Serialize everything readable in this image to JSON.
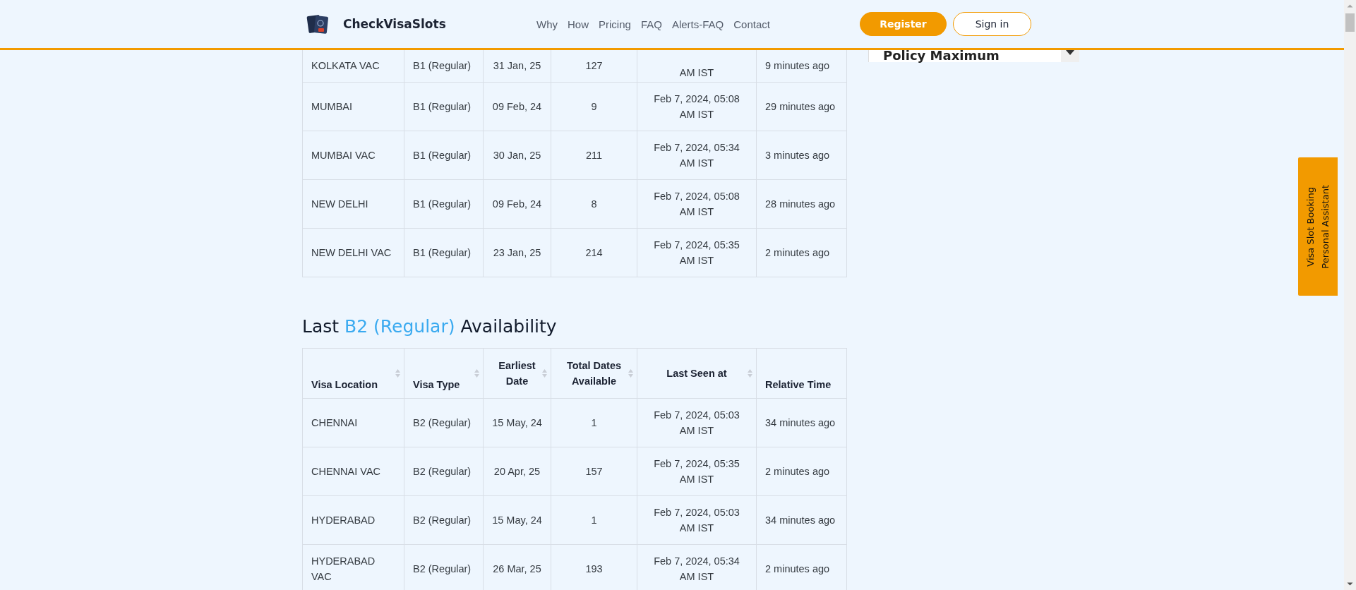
{
  "header": {
    "brand": "CheckVisaSlots",
    "nav": [
      "Why",
      "How",
      "Pricing",
      "FAQ",
      "Alerts-FAQ",
      "Contact"
    ],
    "buttons": [
      {
        "label": "Register",
        "kind": "primary"
      },
      {
        "label": "Sign in",
        "kind": "outline"
      }
    ]
  },
  "b1_table": {
    "rows": [
      {
        "cells": [
          "KOLKATA VAC",
          "B1 (Regular)",
          "31 Jan, 25",
          "127",
          "AM IST",
          "9 minutes ago"
        ]
      },
      {
        "cells": [
          "MUMBAI",
          "B1 (Regular)",
          "09 Feb, 24",
          "9",
          "Feb 7, 2024, 05:08 AM IST",
          "29 minutes ago"
        ]
      },
      {
        "cells": [
          "MUMBAI VAC",
          "B1 (Regular)",
          "30 Jan, 25",
          "211",
          "Feb 7, 2024, 05:34 AM IST",
          "3 minutes ago"
        ]
      },
      {
        "cells": [
          "NEW DELHI",
          "B1 (Regular)",
          "09 Feb, 24",
          "8",
          "Feb 7, 2024, 05:08 AM IST",
          "28 minutes ago"
        ]
      },
      {
        "cells": [
          "NEW DELHI VAC",
          "B1 (Regular)",
          "23 Jan, 25",
          "214",
          "Feb 7, 2024, 05:35 AM IST",
          "2 minutes ago"
        ]
      }
    ]
  },
  "sidebar": {
    "select": {
      "value": "Policy Maximum"
    }
  },
  "b2_section": {
    "heading": {
      "prefix": "Last",
      "highlight": "B2 (Regular)",
      "suffix": "Availability"
    },
    "columns": [
      {
        "label": "Visa Location",
        "sortable": true
      },
      {
        "label": "Visa Type",
        "sortable": true
      },
      {
        "label": "Earliest Date",
        "sortable": true
      },
      {
        "label": "Total Dates Available",
        "sortable": true
      },
      {
        "label": "Last Seen at",
        "sortable": true
      },
      {
        "label": "Relative Time",
        "sortable": false
      }
    ],
    "rows": [
      {
        "cells": [
          "CHENNAI",
          "B2 (Regular)",
          "15 May, 24",
          "1",
          "Feb 7, 2024, 05:03 AM IST",
          "34 minutes ago"
        ]
      },
      {
        "cells": [
          "CHENNAI VAC",
          "B2 (Regular)",
          "20 Apr, 25",
          "157",
          "Feb 7, 2024, 05:35 AM IST",
          "2 minutes ago"
        ]
      },
      {
        "cells": [
          "HYDERABAD",
          "B2 (Regular)",
          "15 May, 24",
          "1",
          "Feb 7, 2024, 05:03 AM IST",
          "34 minutes ago"
        ]
      },
      {
        "cells": [
          "HYDERABAD VAC",
          "B2 (Regular)",
          "26 Mar, 25",
          "193",
          "Feb 7, 2024, 05:34 AM IST",
          "2 minutes ago"
        ]
      }
    ]
  },
  "side_tab": {
    "lines": [
      "Visa Slot Booking",
      "Personal Assistant"
    ]
  }
}
